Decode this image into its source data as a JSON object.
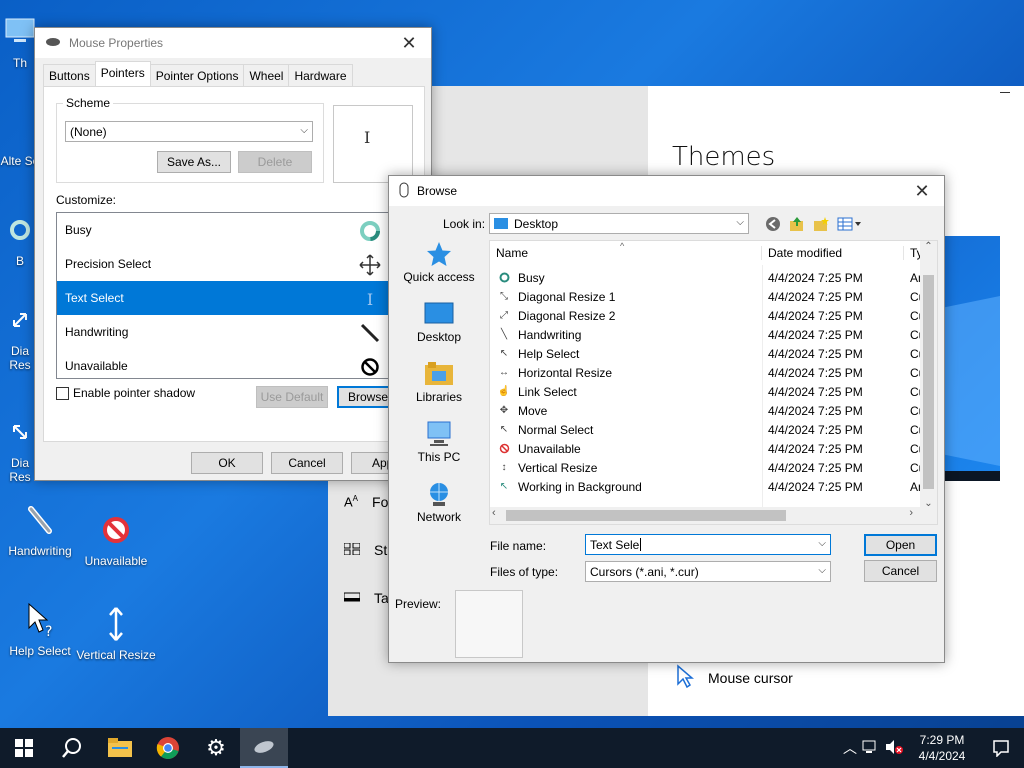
{
  "desktop": {
    "icons": [
      {
        "label": "Th"
      },
      {
        "label": "Alte Se"
      },
      {
        "label": "B"
      },
      {
        "label": "Dia Res"
      },
      {
        "label": "Dia Res"
      },
      {
        "label": "Handwriting"
      },
      {
        "label": "Unavailable"
      },
      {
        "label": "Help Select"
      },
      {
        "label": "Vertical Resize"
      }
    ]
  },
  "settings": {
    "title": "Themes",
    "nav": [
      {
        "label": "Fo",
        "icon": "font-icon"
      },
      {
        "label": "St",
        "icon": "start-icon"
      },
      {
        "label": "Ta",
        "icon": "taskbar-icon"
      }
    ],
    "mouse_cursor_label": "Mouse cursor"
  },
  "mouse": {
    "title": "Mouse Properties",
    "tabs": [
      "Buttons",
      "Pointers",
      "Pointer Options",
      "Wheel",
      "Hardware"
    ],
    "active_tab": "Pointers",
    "scheme_label": "Scheme",
    "scheme_value": "(None)",
    "save_as": "Save As...",
    "delete": "Delete",
    "customize_label": "Customize:",
    "cursors": [
      {
        "label": "Busy",
        "icon": "busy-icon"
      },
      {
        "label": "Precision Select",
        "icon": "precision-select-icon"
      },
      {
        "label": "Text Select",
        "icon": "text-select-icon",
        "selected": true
      },
      {
        "label": "Handwriting",
        "icon": "handwriting-icon"
      },
      {
        "label": "Unavailable",
        "icon": "unavailable-icon"
      }
    ],
    "enable_shadow": "Enable pointer shadow",
    "use_default": "Use Default",
    "browse": "Browse...",
    "ok": "OK",
    "cancel": "Cancel",
    "apply": "Apply"
  },
  "browse": {
    "title": "Browse",
    "look_in_label": "Look in:",
    "look_in_value": "Desktop",
    "places": [
      {
        "label": "Quick access",
        "icon": "quick-access-icon"
      },
      {
        "label": "Desktop",
        "icon": "desktop-icon"
      },
      {
        "label": "Libraries",
        "icon": "libraries-icon"
      },
      {
        "label": "This PC",
        "icon": "this-pc-icon"
      },
      {
        "label": "Network",
        "icon": "network-icon"
      }
    ],
    "columns": [
      "Name",
      "Date modified",
      "Ty"
    ],
    "files": [
      {
        "name": "Busy",
        "date": "4/4/2024 7:25 PM",
        "type": "An"
      },
      {
        "name": "Diagonal Resize 1",
        "date": "4/4/2024 7:25 PM",
        "type": "Cu"
      },
      {
        "name": "Diagonal Resize 2",
        "date": "4/4/2024 7:25 PM",
        "type": "Cu"
      },
      {
        "name": "Handwriting",
        "date": "4/4/2024 7:25 PM",
        "type": "Cu"
      },
      {
        "name": "Help Select",
        "date": "4/4/2024 7:25 PM",
        "type": "Cu"
      },
      {
        "name": "Horizontal Resize",
        "date": "4/4/2024 7:25 PM",
        "type": "Cu"
      },
      {
        "name": "Link Select",
        "date": "4/4/2024 7:25 PM",
        "type": "Cu"
      },
      {
        "name": "Move",
        "date": "4/4/2024 7:25 PM",
        "type": "Cu"
      },
      {
        "name": "Normal Select",
        "date": "4/4/2024 7:25 PM",
        "type": "Cu"
      },
      {
        "name": "Unavailable",
        "date": "4/4/2024 7:25 PM",
        "type": "Cu"
      },
      {
        "name": "Vertical Resize",
        "date": "4/4/2024 7:25 PM",
        "type": "Cu"
      },
      {
        "name": "Working in Background",
        "date": "4/4/2024 7:25 PM",
        "type": "An"
      }
    ],
    "file_name_label": "File name:",
    "file_name_value": "Text Sele",
    "files_of_type_label": "Files of type:",
    "files_of_type_value": "Cursors (*.ani, *.cur)",
    "open": "Open",
    "cancel": "Cancel",
    "preview_label": "Preview:"
  },
  "taskbar": {
    "time": "7:29 PM",
    "date": "4/4/2024"
  }
}
